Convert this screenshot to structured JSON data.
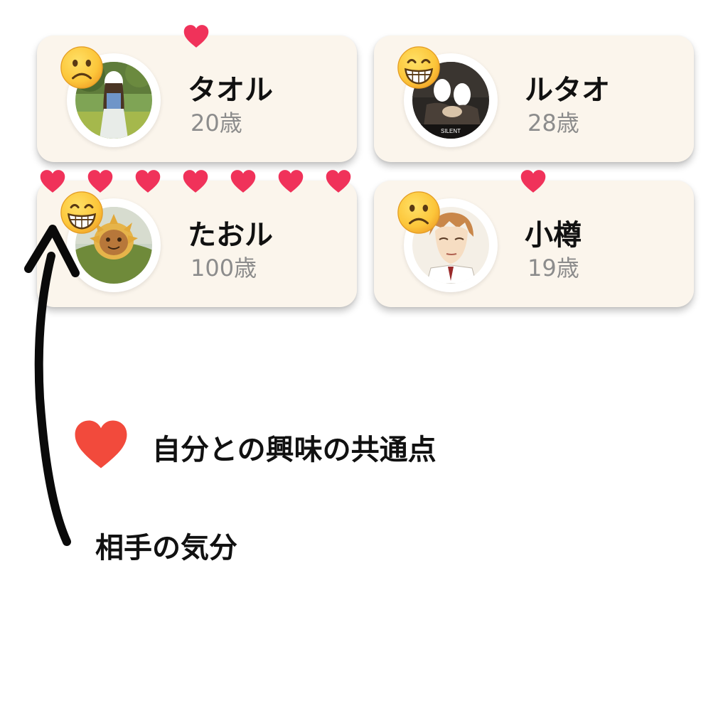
{
  "cards": [
    {
      "name": "タオル",
      "age": "20歳",
      "mood_icon": "frowning-face-icon",
      "shared_interests": 1
    },
    {
      "name": "ルタオ",
      "age": "28歳",
      "mood_icon": "grinning-face-icon",
      "shared_interests": 0,
      "avatar_caption": "SILENT"
    },
    {
      "name": "たおル",
      "age": "100歳",
      "mood_icon": "grinning-face-icon",
      "shared_interests": 7
    },
    {
      "name": "小樽",
      "age": "19歳",
      "mood_icon": "frowning-face-icon",
      "shared_interests": 1
    }
  ],
  "legend": {
    "heart_label": "自分との興味の共通点",
    "mood_label": "相手の気分"
  },
  "colors": {
    "card_background": "#fbf5ec",
    "heart_small": "#f0325a",
    "heart_legend": "#f24a3c",
    "age_text": "#8c8c8c",
    "emoji_yellow": "#fbc233"
  }
}
